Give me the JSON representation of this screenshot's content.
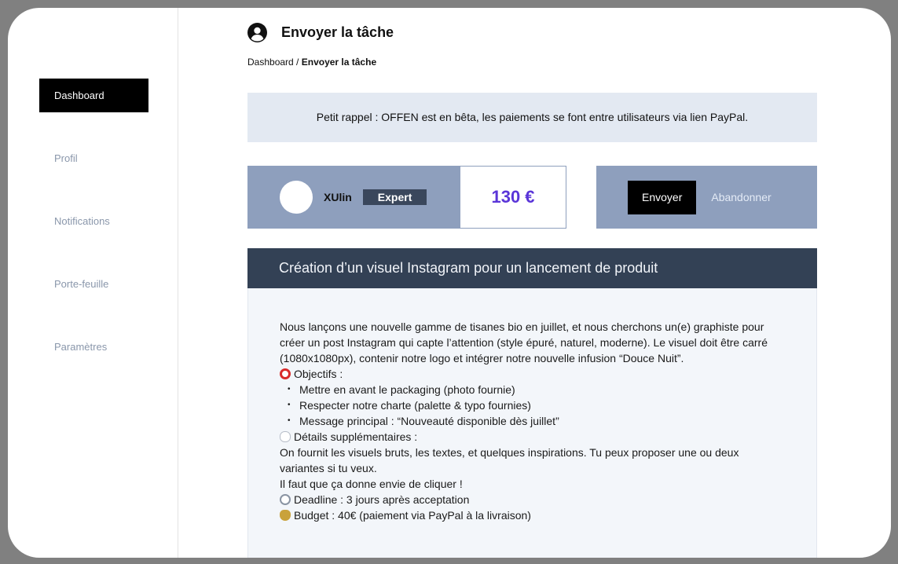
{
  "sidebar": {
    "items": [
      {
        "label": "Dashboard"
      },
      {
        "label": "Profil"
      },
      {
        "label": "Notifications"
      },
      {
        "label": "Porte-feuille"
      },
      {
        "label": "Paramètres"
      }
    ]
  },
  "header": {
    "title": "Envoyer la tâche",
    "icon": "user-circle-icon"
  },
  "breadcrumb": {
    "root": "Dashboard",
    "separator": " / ",
    "current": "Envoyer la tâche"
  },
  "notice": {
    "text": "Petit rappel : OFFEN est en bêta, les paiements se font entre utilisateurs via lien PayPal."
  },
  "offer": {
    "username": "XUlin",
    "badge": "Expert",
    "price": "130 €",
    "send_label": "Envoyer",
    "abandon_label": "Abandonner"
  },
  "task": {
    "title": "Création d’un visuel Instagram pour un lancement de produit",
    "intro": "Nous lançons une nouvelle gamme de tisanes bio en juillet, et nous cherchons un(e) graphiste pour créer un post Instagram qui capte l’attention (style épuré, naturel, moderne). Le visuel doit être carré (1080x1080px), contenir notre logo et intégrer notre nouvelle infusion “Douce Nuit”.",
    "objectives_heading": "Objectifs :",
    "objectives": [
      "Mettre en avant le packaging (photo fournie)",
      "Respecter notre charte (palette & typo fournies)",
      "Message principal : “Nouveauté disponible dès juillet”"
    ],
    "details_heading": "Détails supplémentaires :",
    "details": "On fournit les visuels bruts, les textes, et quelques inspirations. Tu peux proposer une ou deux variantes si tu veux.",
    "cta": "Il faut que ça donne envie de cliquer !",
    "deadline": "Deadline : 3 jours après acceptation",
    "budget": "Budget : 40€ (paiement via PayPal à la livraison)"
  },
  "colors": {
    "accent_price": "#5a35d8",
    "card_bg": "#8e9fbd",
    "header_bg": "#334155",
    "notice_bg": "#e3e9f2"
  }
}
